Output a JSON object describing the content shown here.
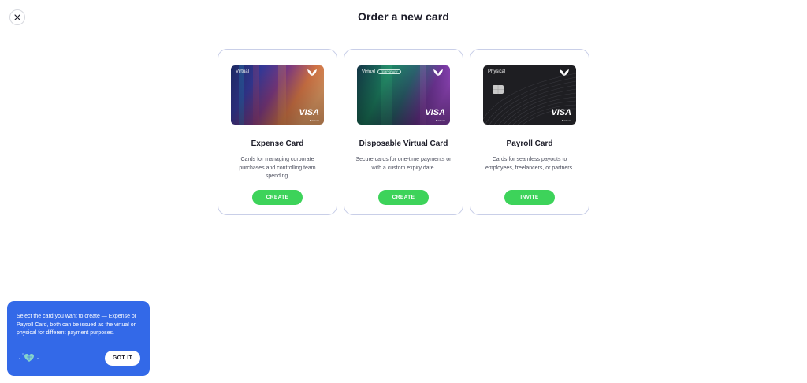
{
  "header": {
    "title": "Order a new card",
    "close_icon": "close-icon"
  },
  "cards": [
    {
      "type_label": "Virtual",
      "badge": "",
      "title": "Expense Card",
      "description": "Cards for managing corporate purchases and controlling team spending.",
      "button": "CREATE",
      "brand": "VISA",
      "brand_sub": "Business"
    },
    {
      "type_label": "Virtual",
      "badge": "TEMPORARY",
      "title": "Disposable Virtual Card",
      "description": "Secure cards for one-time payments or with a custom expiry date.",
      "button": "CREATE",
      "brand": "VISA",
      "brand_sub": "Business"
    },
    {
      "type_label": "Physical",
      "badge": "",
      "title": "Payroll Card",
      "description": "Cards for seamless payouts to employees, freelancers, or partners.",
      "button": "INVITE",
      "brand": "VISA",
      "brand_sub": "Business"
    }
  ],
  "tooltip": {
    "text": "Select the card you want to create — Expense or Payroll Card, both can be issued as the virtual or physical for different payment purposes.",
    "button": "GOT IT",
    "icon": "sparkle-heart-icon"
  },
  "colors": {
    "accent_green": "#3dd35a",
    "tooltip_blue": "#3369e8",
    "card_border": "#c9cfe8"
  }
}
